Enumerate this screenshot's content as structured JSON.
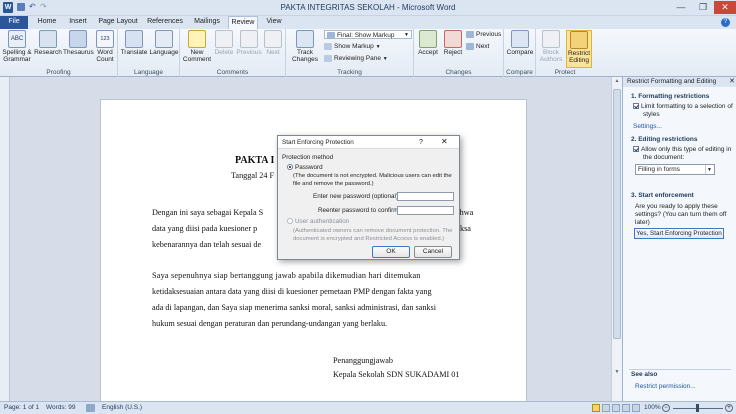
{
  "window": {
    "title": "PAKTA INTEGRITAS SEKOLAH - Microsoft Word"
  },
  "tabs": [
    {
      "label": "File"
    },
    {
      "label": "Home"
    },
    {
      "label": "Insert"
    },
    {
      "label": "Page Layout"
    },
    {
      "label": "References"
    },
    {
      "label": "Mailings"
    },
    {
      "label": "Review"
    },
    {
      "label": "View"
    }
  ],
  "ribbon": {
    "proofing": {
      "label": "Proofing",
      "spelling": "Spelling & Grammar",
      "research": "Research",
      "thesaurus": "Thesaurus",
      "wordcount": "Word Count"
    },
    "language": {
      "label": "Language",
      "translate": "Translate",
      "language": "Language"
    },
    "comments": {
      "label": "Comments",
      "new": "New Comment",
      "delete": "Delete",
      "previous": "Previous",
      "next": "Next"
    },
    "tracking": {
      "label": "Tracking",
      "track": "Track Changes",
      "final": "Final: Show Markup",
      "show_markup": "Show Markup",
      "reviewing_pane": "Reviewing Pane"
    },
    "changes": {
      "label": "Changes",
      "accept": "Accept",
      "reject": "Reject",
      "previous": "Previous",
      "next": "Next"
    },
    "compare": {
      "label": "Compare",
      "compare": "Compare"
    },
    "protect": {
      "label": "Protect",
      "block": "Block Authors",
      "restrict": "Restrict Editing"
    }
  },
  "document": {
    "title": "PAKTA I",
    "date": "Tanggal 24 F",
    "p1": [
      {
        "left": "Dengan ini saya sebagai Kepala S",
        "right": "ahwa"
      },
      {
        "left": "data yang diisi pada kuesioner p",
        "right": "riksa"
      },
      {
        "left": "kebenarannya dan telah sesuai de",
        "right": ""
      }
    ],
    "p2": [
      "Saya sepenuhnya siap bertanggung jawab apabila dikemudian hari ditemukan",
      "ketidaksesuaian antara data yang diisi di kuesioner pemetaan PMP dengan fakta yang",
      "ada di lapangan, dan Saya siap menerima sanksi moral, sanksi administrasi, dan sanksi",
      "hukum sesuai dengan peraturan dan perundang-undangan yang berlaku."
    ],
    "sign1": "Penanggungjawab",
    "sign2": "Kepala Sekolah SDN SUKADAMI 01"
  },
  "dialog": {
    "title": "Start Enforcing Protection",
    "help": "?",
    "close": "✕",
    "method_label": "Protection method",
    "password_label": "Password",
    "password_note1": "(The document is not encrypted. Malicious users can edit the",
    "password_note2": "file and remove the password.)",
    "new_pw_label": "Enter new password (optional):",
    "confirm_pw_label": "Reenter password to confirm:",
    "userauth_label": "User authentication",
    "userauth_note1": "(Authenticated owners can remove document protection. The",
    "userauth_note2": "document is encrypted and Restricted Access is enabled.)",
    "ok": "OK",
    "cancel": "Cancel"
  },
  "pane": {
    "header": "Restrict Formatting and Editing",
    "s1": "1. Formatting restrictions",
    "s1_check1": "Limit formatting to a selection of",
    "s1_check2": "styles",
    "settings": "Settings...",
    "s2": "2. Editing restrictions",
    "s2_check1": "Allow only this type of editing in",
    "s2_check2": "the document:",
    "edit_type": "Filling in forms",
    "s3": "3. Start enforcement",
    "s3_text1": "Are you ready to apply these",
    "s3_text2": "settings? (You can turn them off",
    "s3_text3": "later)",
    "start_btn": "Yes, Start Enforcing Protection",
    "see_also": "See also",
    "restrict_perm": "Restrict permission..."
  },
  "status": {
    "page": "Page: 1 of 1",
    "words": "Words: 99",
    "lang": "English (U.S.)",
    "zoom": "100%"
  },
  "colors": {
    "file_tab": "#2b579a",
    "accent": "#1e395b"
  }
}
